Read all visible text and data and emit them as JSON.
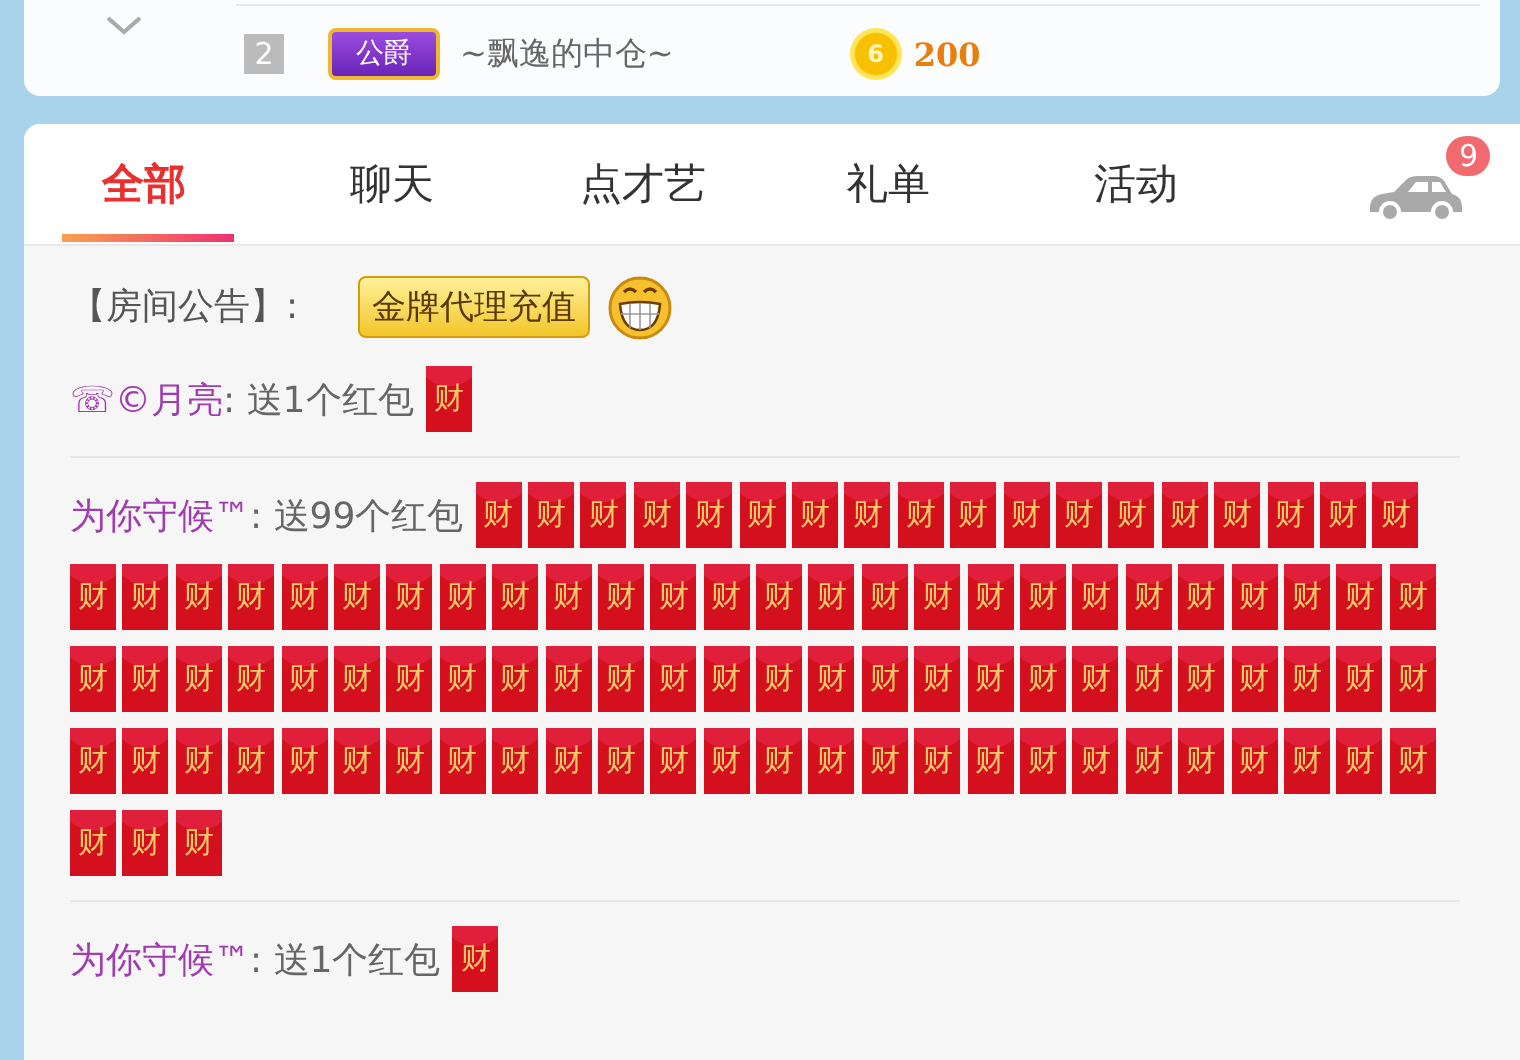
{
  "top_row": {
    "rank": "2",
    "title_badge": "公爵",
    "name": "~飘逸的中仓~",
    "coin": "6",
    "amount": "200"
  },
  "tabs": [
    {
      "label": "全部",
      "selected": true
    },
    {
      "label": "聊天",
      "selected": false
    },
    {
      "label": "点才艺",
      "selected": false
    },
    {
      "label": "礼单",
      "selected": false
    },
    {
      "label": "活动",
      "selected": false
    }
  ],
  "car_badge": "9",
  "announcement": {
    "label": "【房间公告】:",
    "button": "金牌代理充值"
  },
  "messages": [
    {
      "sender": "☏©月亮",
      "text": ": 送1个红包",
      "packets": [
        "财"
      ]
    },
    {
      "sender": "为你守候™",
      "text": ": 送99个红包",
      "packets": [
        "财",
        "财",
        "财",
        "财",
        "财",
        "财",
        "财",
        "财",
        "财",
        "财",
        "财",
        "财",
        "财",
        "财",
        "财",
        "财",
        "财",
        "财",
        "财",
        "财",
        "财",
        "财",
        "财",
        "财",
        "财",
        "财",
        "财",
        "财",
        "财",
        "财",
        "财",
        "财",
        "财",
        "财",
        "财",
        "财",
        "财",
        "财",
        "财",
        "财",
        "财",
        "财",
        "财",
        "财",
        "财",
        "财",
        "财",
        "财",
        "财",
        "财",
        "财",
        "财",
        "财",
        "财",
        "财",
        "财",
        "财",
        "财",
        "财",
        "财",
        "财",
        "财",
        "财",
        "财",
        "财",
        "财",
        "财",
        "财",
        "财",
        "财",
        "财",
        "财",
        "财",
        "财",
        "财",
        "财",
        "财",
        "财",
        "财",
        "财",
        "财",
        "财",
        "财",
        "财",
        "财",
        "财",
        "财",
        "财",
        "财",
        "财",
        "财",
        "财",
        "财",
        "财",
        "财",
        "财",
        "财",
        "财",
        "财"
      ]
    },
    {
      "sender": "为你守候™",
      "text": ": 送1个红包",
      "packets": [
        "财"
      ]
    }
  ]
}
